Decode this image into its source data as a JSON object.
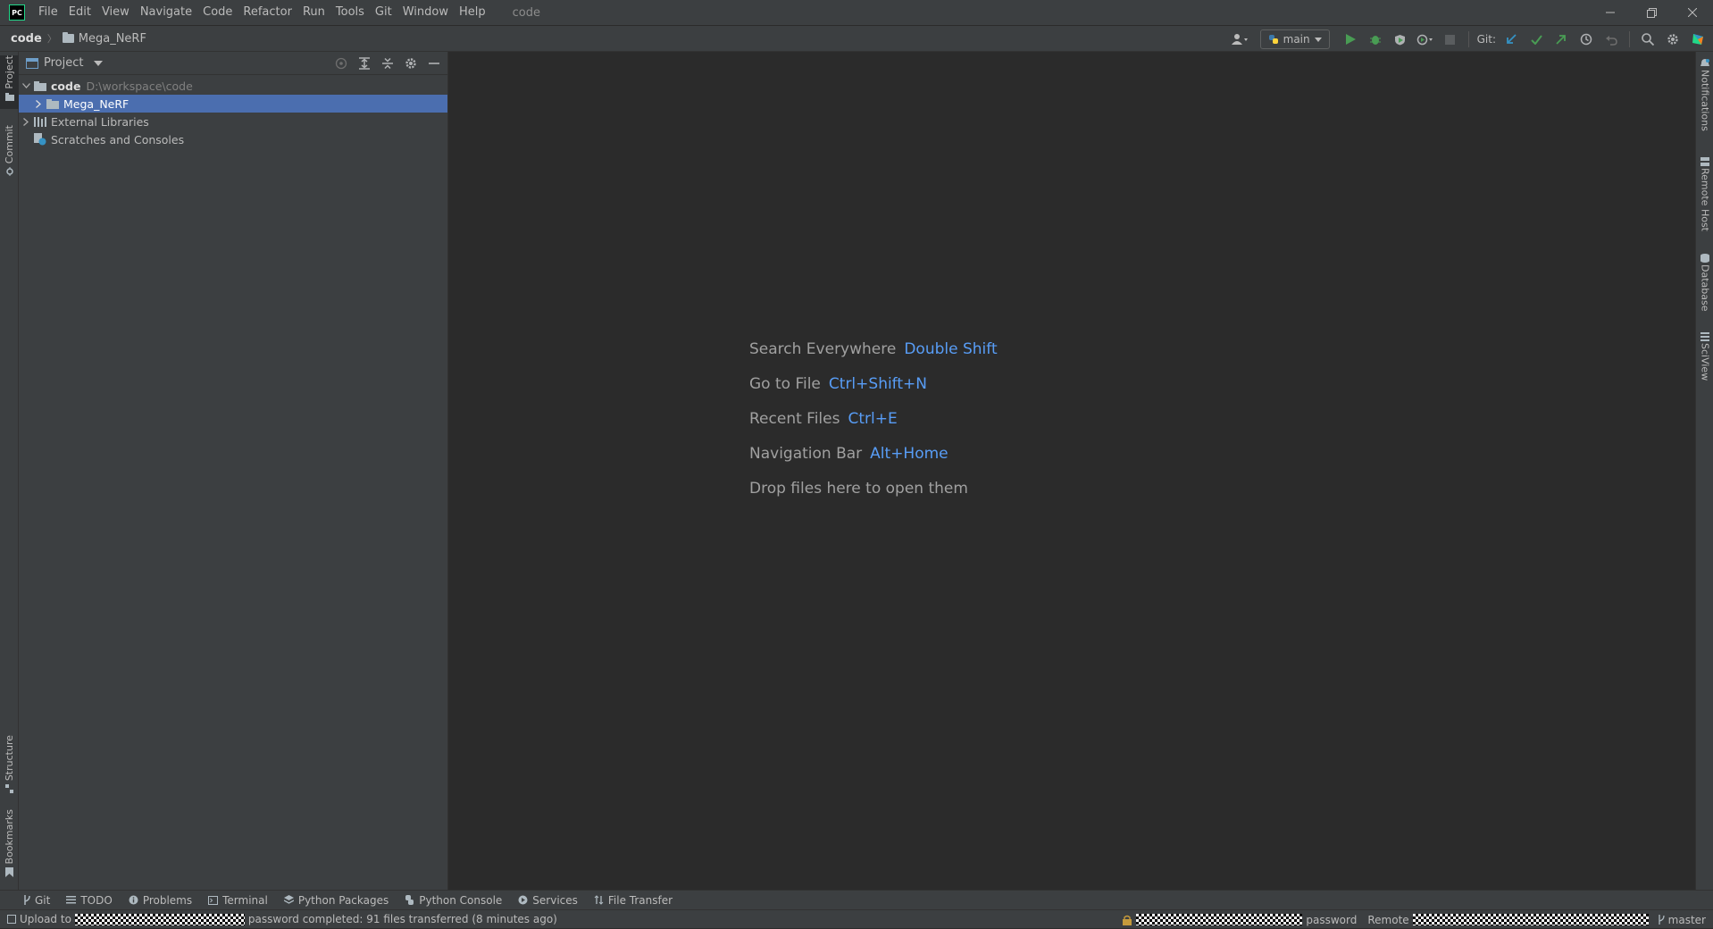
{
  "titlebar": {
    "logo_text": "PC",
    "menu": [
      "File",
      "Edit",
      "View",
      "Navigate",
      "Code",
      "Refactor",
      "Run",
      "Tools",
      "Git",
      "Window",
      "Help"
    ],
    "window_title": "code"
  },
  "navbar": {
    "root": "code",
    "folder": "Mega_NeRF",
    "run_config": "main",
    "git_label": "Git:"
  },
  "left_stripe": {
    "project": "Project",
    "commit": "Commit",
    "structure": "Structure",
    "bookmarks": "Bookmarks"
  },
  "project_panel": {
    "title": "Project",
    "tree": [
      {
        "name": "code",
        "path": "D:\\workspace\\code"
      },
      {
        "name": "Mega_NeRF"
      },
      {
        "name": "External Libraries"
      },
      {
        "name": "Scratches and Consoles"
      }
    ]
  },
  "editor": {
    "hints": [
      {
        "label": "Search Everywhere",
        "key": "Double Shift"
      },
      {
        "label": "Go to File",
        "key": "Ctrl+Shift+N"
      },
      {
        "label": "Recent Files",
        "key": "Ctrl+E"
      },
      {
        "label": "Navigation Bar",
        "key": "Alt+Home"
      },
      {
        "label": "Drop files here to open them",
        "key": ""
      }
    ]
  },
  "right_stripe": {
    "notifications": "Notifications",
    "remote_host": "Remote Host",
    "database": "Database",
    "sciview": "SciView"
  },
  "bottom_tabs": [
    "Git",
    "TODO",
    "Problems",
    "Terminal",
    "Python Packages",
    "Python Console",
    "Services",
    "File Transfer"
  ],
  "status": {
    "left_prefix": "Upload to",
    "left_suffix": "password completed: 91 files transferred (8 minutes ago)",
    "right_password": "password",
    "right_remote": "Remote",
    "branch": "master"
  },
  "colors": {
    "accent": "#4b6eaf",
    "link": "#589df6",
    "run_green": "#499c54"
  }
}
